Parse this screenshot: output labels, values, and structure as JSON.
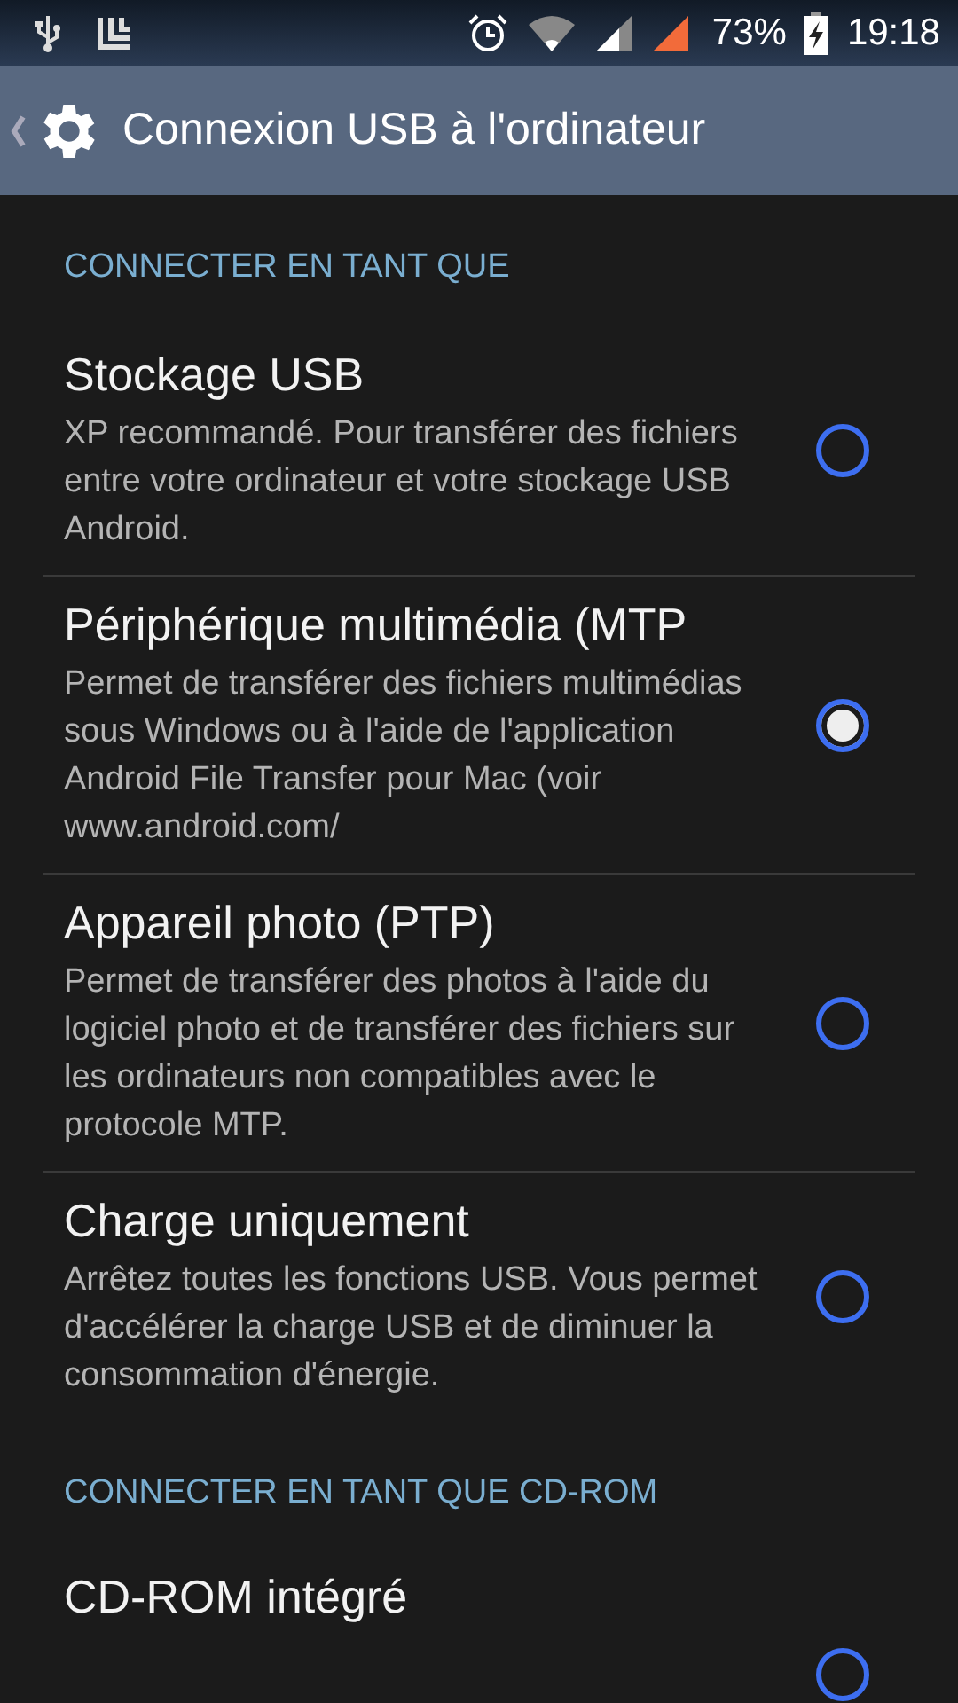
{
  "status_bar": {
    "battery": "73%",
    "time": "19:18"
  },
  "action_bar": {
    "title": "Connexion USB à l'ordinateur"
  },
  "sections": [
    {
      "header": "CONNECTER EN TANT QUE",
      "items": [
        {
          "title": "Stockage USB",
          "description": "XP recommandé. Pour transférer des fichiers entre votre ordinateur et votre stockage USB Android.",
          "selected": false
        },
        {
          "title": "Périphérique multimédia (MTP",
          "description": "Permet de transférer des fichiers multimédias sous Windows ou à l'aide de l'application Android File Transfer pour Mac (voir www.android.com/",
          "selected": true
        },
        {
          "title": "Appareil photo (PTP)",
          "description": "Permet de transférer des photos à l'aide du logiciel photo et de transférer des fichiers sur les ordinateurs non compatibles avec le protocole MTP.",
          "selected": false
        },
        {
          "title": "Charge uniquement",
          "description": "Arrêtez toutes les fonctions USB. Vous permet d'accélérer la charge USB et de diminuer la consommation d'énergie.",
          "selected": false
        }
      ]
    },
    {
      "header": "CONNECTER EN TANT QUE CD-ROM",
      "items": [
        {
          "title": "CD-ROM intégré",
          "selected": false
        }
      ]
    }
  ]
}
